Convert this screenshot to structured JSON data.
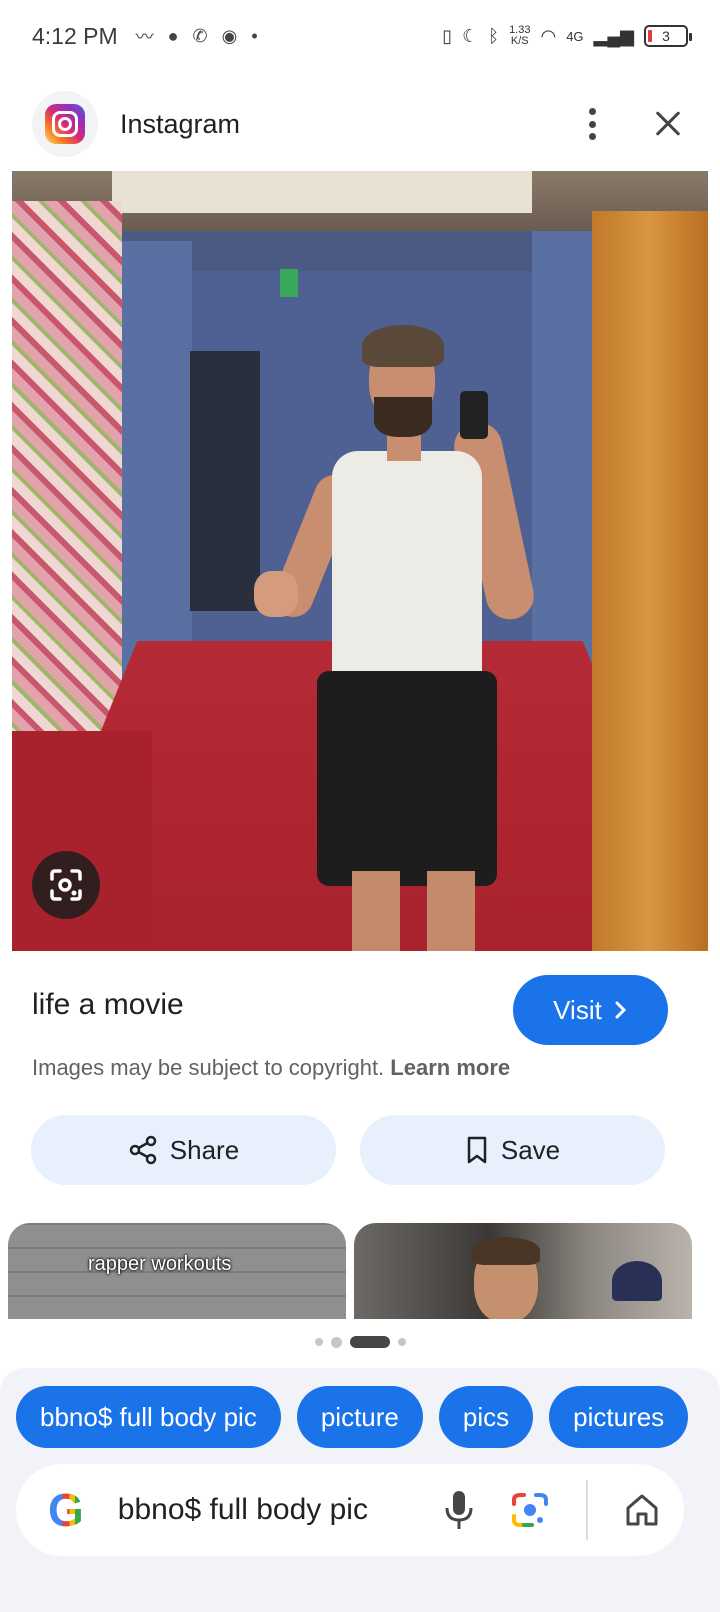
{
  "status_bar": {
    "time": "4:12 PM",
    "net_speed_value": "1.33",
    "net_speed_unit": "K/S",
    "network": "4G",
    "battery": "3"
  },
  "header": {
    "app_name": "Instagram"
  },
  "result": {
    "title": "life a movie",
    "visit_label": "Visit",
    "copyright_text": "Images may be subject to copyright.",
    "learn_more": "Learn more",
    "share_label": "Share",
    "save_label": "Save"
  },
  "related": {
    "card1_caption": "rapper workouts"
  },
  "suggestions": [
    "bbno$ full body pic",
    "picture",
    "pics",
    "pictures"
  ],
  "search": {
    "query": "bbno$ full body pic",
    "logo": "G"
  },
  "colors": {
    "accent": "#1a73e8",
    "chip_bg": "#1a73e8",
    "action_bg": "#e8f0fe"
  }
}
